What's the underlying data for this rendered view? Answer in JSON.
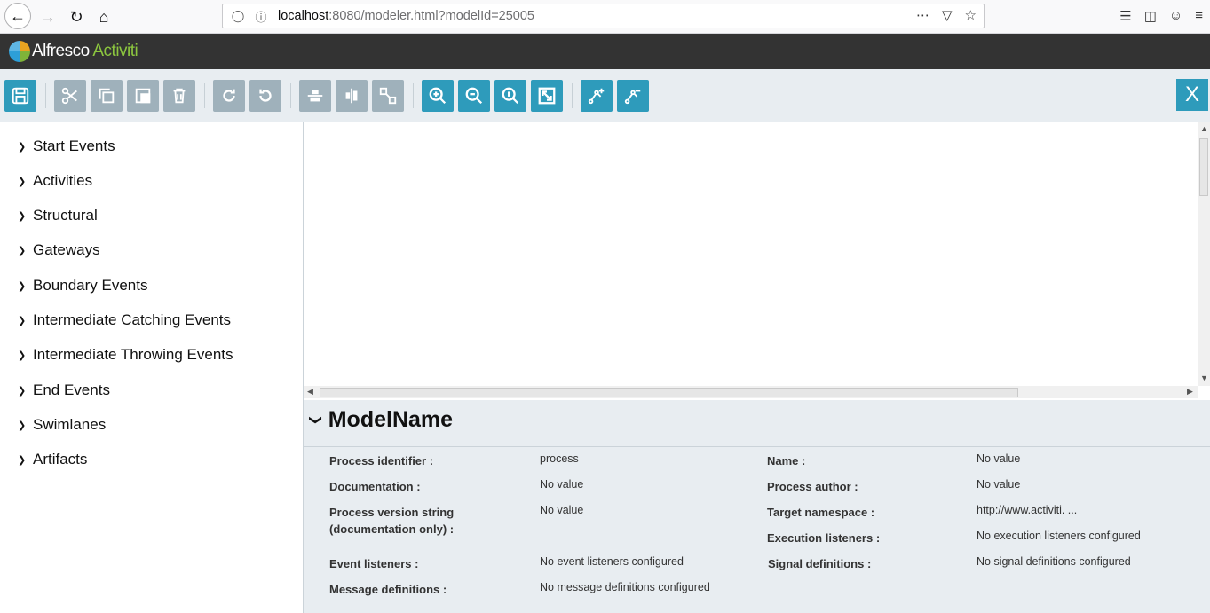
{
  "browser": {
    "url_host": "localhost",
    "url_rest": ":8080/modeler.html?modelId=25005",
    "icons": [
      "back-icon",
      "forward-icon",
      "reload-icon",
      "home-icon",
      "shield-icon",
      "info-icon",
      "more-icon",
      "pocket-icon",
      "star-icon",
      "library-icon",
      "sidebar-icon",
      "account-icon",
      "menu-icon"
    ]
  },
  "header": {
    "brand_primary": "Alfresco",
    "brand_secondary": "Activiti"
  },
  "toolbar": {
    "buttons": [
      "save",
      "cut",
      "copy",
      "paste",
      "delete",
      "redo",
      "undo",
      "align-horizontal",
      "align-vertical",
      "same-size",
      "zoom-in",
      "zoom-out",
      "zoom-actual",
      "zoom-fit",
      "bend-point-add",
      "bend-point-remove"
    ],
    "close_label": "X"
  },
  "palette": {
    "items": [
      {
        "label": "Start Events"
      },
      {
        "label": "Activities"
      },
      {
        "label": "Structural"
      },
      {
        "label": "Gateways"
      },
      {
        "label": "Boundary Events"
      },
      {
        "label": "Intermediate Catching Events"
      },
      {
        "label": "Intermediate Throwing Events"
      },
      {
        "label": "End Events"
      },
      {
        "label": "Swimlanes"
      },
      {
        "label": "Artifacts"
      }
    ]
  },
  "properties": {
    "title": "ModelName",
    "rows": {
      "process_identifier": {
        "label": "Process identifier :",
        "value": "process"
      },
      "name": {
        "label": "Name :",
        "value": "No value"
      },
      "documentation": {
        "label": "Documentation :",
        "value": "No value"
      },
      "process_author": {
        "label": "Process author :",
        "value": "No value"
      },
      "version_line1": "Process version string",
      "version_line2": "(documentation only) :",
      "version_value": "No value",
      "target_namespace": {
        "label": "Target namespace :",
        "value": "http://www.activiti. ..."
      },
      "execution_listeners": {
        "label": "Execution listeners :",
        "value": "No execution listeners configured"
      },
      "event_listeners": {
        "label": "Event listeners :",
        "value": "No event listeners configured"
      },
      "signal_definitions": {
        "label": "Signal definitions :",
        "value": "No signal definitions configured"
      },
      "message_definitions": {
        "label": "Message definitions :",
        "value": "No message definitions configured"
      }
    }
  },
  "colors": {
    "accent": "#2e9bbb",
    "toolbar_button": "#9fb1bb",
    "header_bg": "#333333",
    "brand_green": "#8cc63f"
  }
}
